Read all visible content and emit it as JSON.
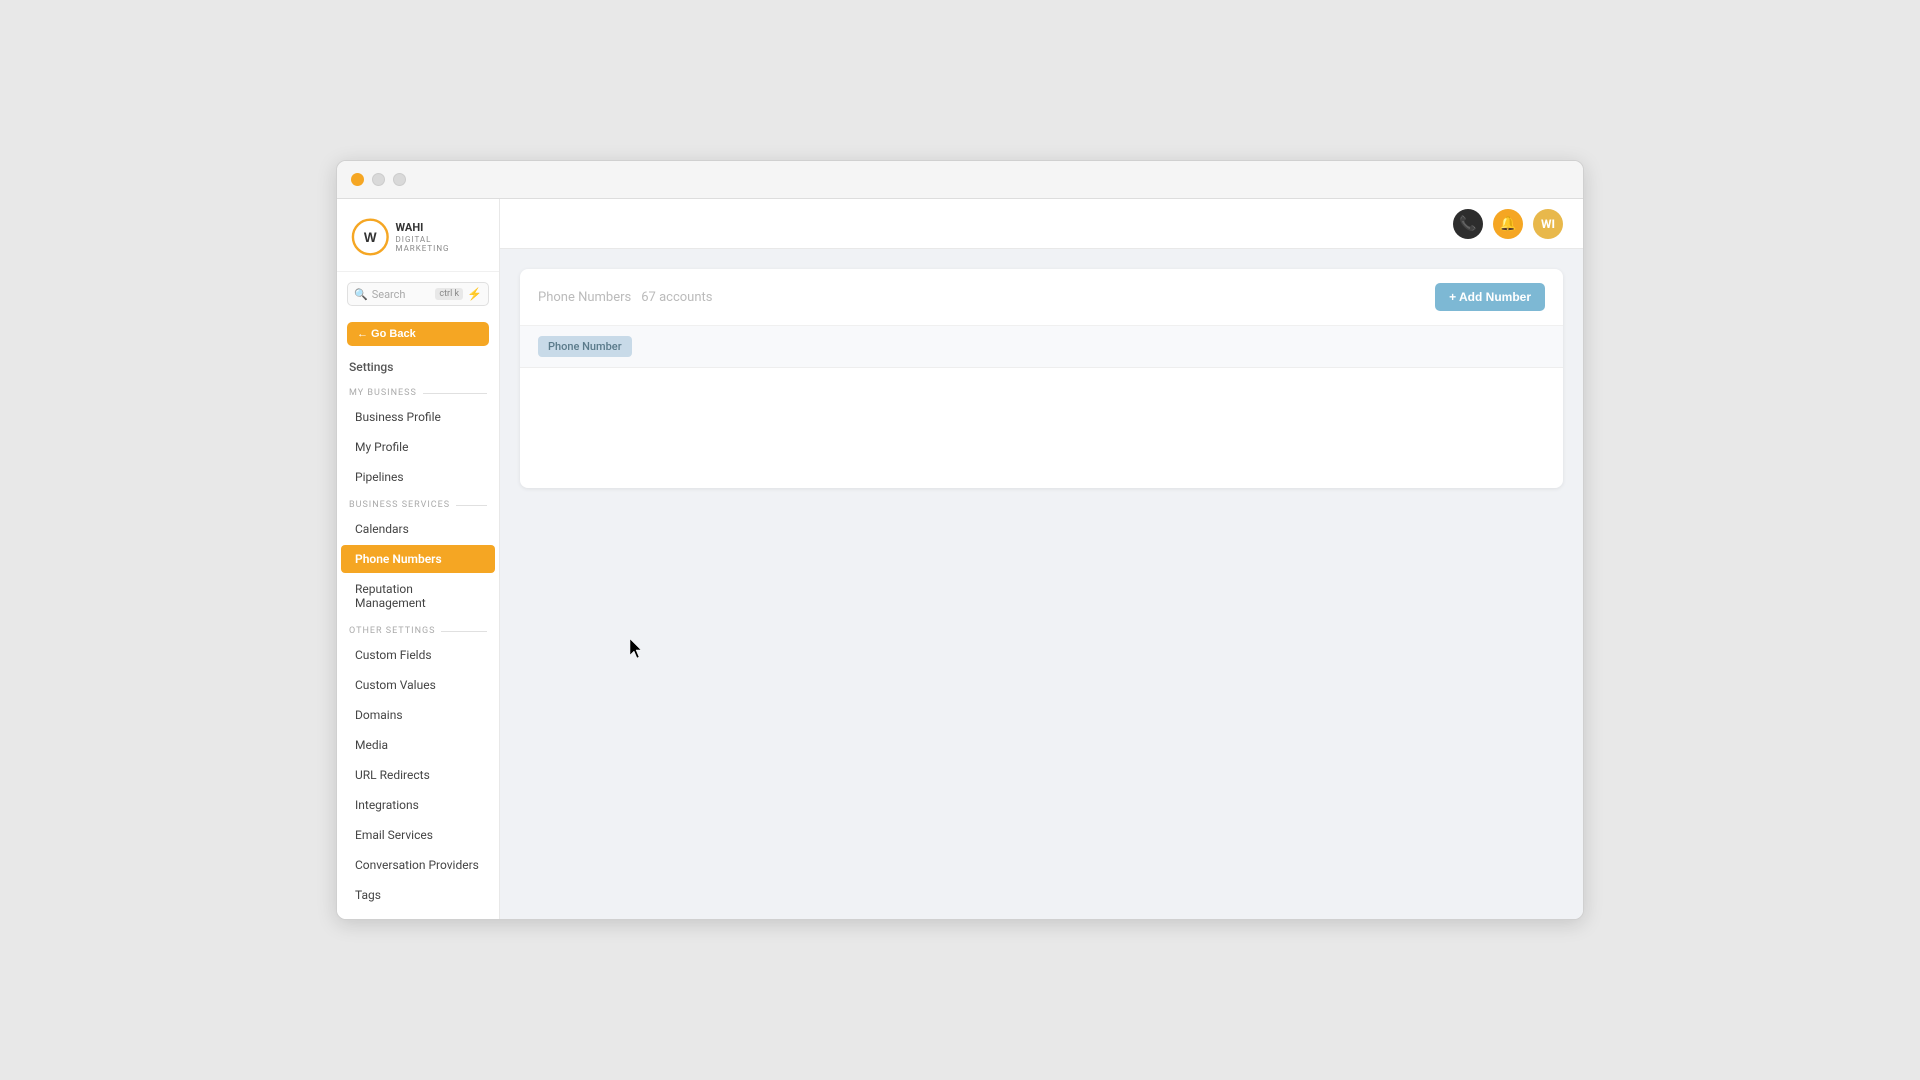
{
  "browser": {
    "traffic_lights": [
      "red",
      "yellow",
      "green"
    ]
  },
  "logo": {
    "text": "WAHI",
    "subtext": "DIGITAL MARKETING"
  },
  "search": {
    "placeholder": "Search",
    "shortcut": "ctrl k",
    "shortcut_display": "ctrl k"
  },
  "go_back": {
    "label": "← Go Back"
  },
  "sidebar": {
    "settings_label": "Settings",
    "sections": [
      {
        "id": "my-business",
        "label": "MY BUSINESS",
        "items": [
          {
            "id": "business-profile",
            "label": "Business Profile",
            "active": false
          },
          {
            "id": "my-profile",
            "label": "My Profile",
            "active": false
          },
          {
            "id": "pipelines",
            "label": "Pipelines",
            "active": false
          }
        ]
      },
      {
        "id": "business-services",
        "label": "BUSINESS SERVICES",
        "items": [
          {
            "id": "calendars",
            "label": "Calendars",
            "active": false
          },
          {
            "id": "phone-numbers",
            "label": "Phone Numbers",
            "active": true
          },
          {
            "id": "reputation-management",
            "label": "Reputation Management",
            "active": false
          }
        ]
      },
      {
        "id": "other-settings",
        "label": "OTHER SETTINGS",
        "items": [
          {
            "id": "custom-fields",
            "label": "Custom Fields",
            "active": false
          },
          {
            "id": "custom-values",
            "label": "Custom Values",
            "active": false
          },
          {
            "id": "domains",
            "label": "Domains",
            "active": false
          },
          {
            "id": "media",
            "label": "Media",
            "active": false
          },
          {
            "id": "url-redirects",
            "label": "URL Redirects",
            "active": false
          },
          {
            "id": "integrations",
            "label": "Integrations",
            "active": false
          },
          {
            "id": "email-services",
            "label": "Email Services",
            "active": false
          },
          {
            "id": "conversation-providers",
            "label": "Conversation Providers",
            "active": false
          },
          {
            "id": "tags",
            "label": "Tags",
            "active": false
          }
        ]
      }
    ]
  },
  "topbar": {
    "phone_icon": "📞",
    "notification_icon": "🔔",
    "avatar_initials": "WI"
  },
  "main": {
    "table": {
      "title": "Phone Numbers",
      "count": "67 accounts",
      "add_button": "+ Add Number",
      "column_header": "Phone Number"
    }
  }
}
